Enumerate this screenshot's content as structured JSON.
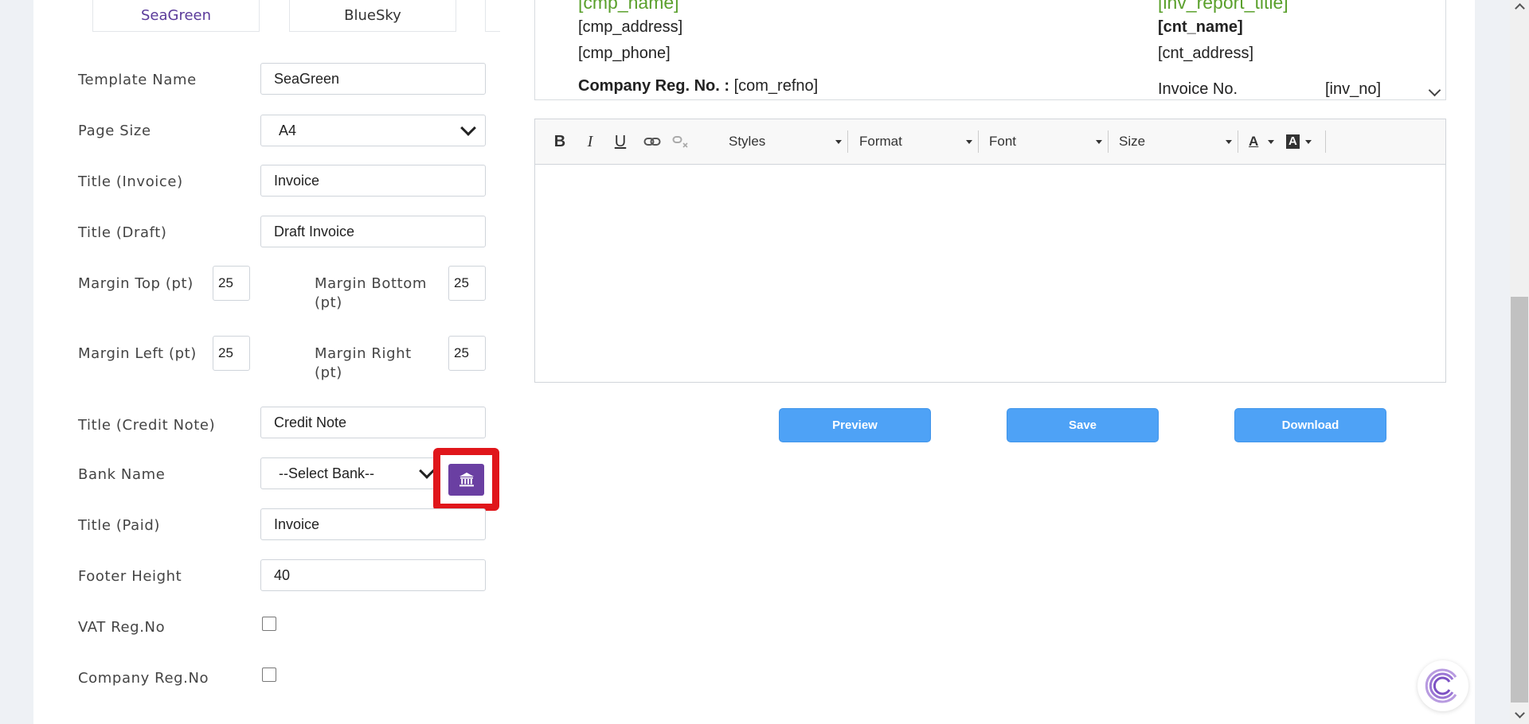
{
  "template_tabs": [
    "SeaGreen",
    "BlueSky"
  ],
  "form": {
    "template_name": {
      "label": "Template Name",
      "value": "SeaGreen"
    },
    "page_size": {
      "label": "Page Size",
      "value": "A4"
    },
    "title_invoice": {
      "label": "Title (Invoice)",
      "value": "Invoice"
    },
    "title_draft": {
      "label": "Title (Draft)",
      "value": "Draft Invoice"
    },
    "margin_top": {
      "label": "Margin Top (pt)",
      "value": "25"
    },
    "margin_bottom": {
      "label_line1": "Margin Bottom",
      "label_line2": "(pt)",
      "value": "25"
    },
    "margin_left": {
      "label": "Margin Left (pt)",
      "value": "25"
    },
    "margin_right": {
      "label_line1": "Margin Right",
      "label_line2": "(pt)",
      "value": "25"
    },
    "title_credit": {
      "label": "Title (Credit Note)",
      "value": "Credit Note"
    },
    "bank_name": {
      "label": "Bank Name",
      "value": "--Select Bank--"
    },
    "title_paid": {
      "label": "Title (Paid)",
      "value": "Invoice"
    },
    "footer_height": {
      "label": "Footer Height",
      "value": "40"
    },
    "vat_reg": {
      "label": "VAT Reg.No"
    },
    "company_reg": {
      "label": "Company Reg.No"
    }
  },
  "preview": {
    "cmp_name": "[cmp_name]",
    "cmp_address": "[cmp_address]",
    "cmp_phone": "[cmp_phone]",
    "company_reg_label": "Company Reg. No. :",
    "company_reg_value": "[com_refno]",
    "report_title": "[inv_report_title]",
    "cnt_name": "[cnt_name]",
    "cnt_address": "[cnt_address]",
    "invoice_no_label": "Invoice No.",
    "invoice_no_value": "[inv_no]"
  },
  "editor": {
    "bold": "B",
    "italic": "I",
    "underline": "U",
    "styles": "Styles",
    "format": "Format",
    "font": "Font",
    "size": "Size",
    "text_color": "A",
    "bg_color": "A"
  },
  "actions": {
    "preview": "Preview",
    "save": "Save",
    "download": "Download"
  },
  "colors": {
    "accent_purple": "#6a3fa2",
    "button_blue": "#4ea2f6",
    "placeholder_green": "#5aa02c",
    "highlight_red": "#e0161b"
  }
}
